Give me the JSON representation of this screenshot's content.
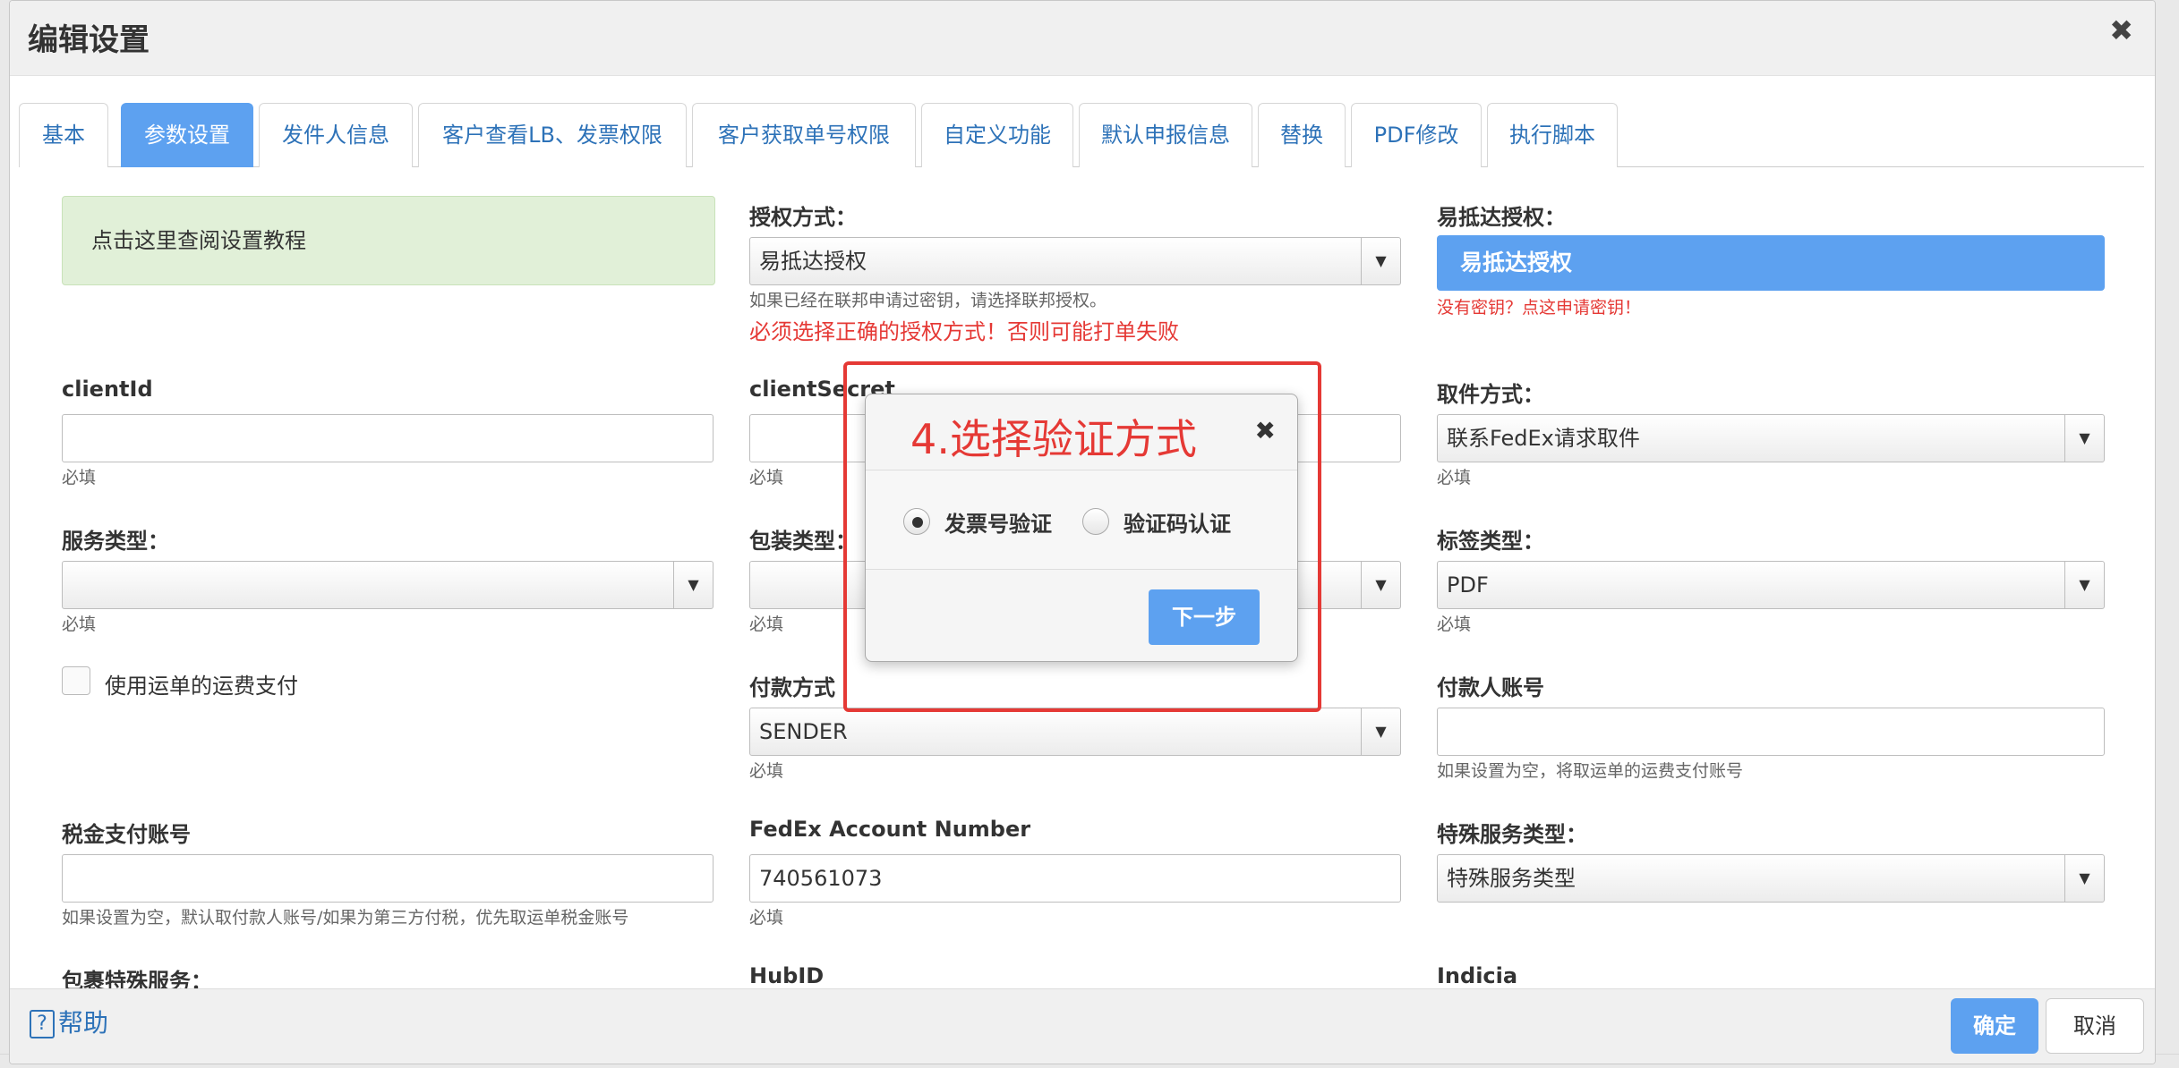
{
  "dialog": {
    "title": "编辑设置"
  },
  "tabs": [
    "基本",
    "参数设置",
    "发件人信息",
    "客户查看LB、发票权限",
    "客户获取单号权限",
    "自定义功能",
    "默认申报信息",
    "替换",
    "PDF修改",
    "执行脚本"
  ],
  "notice": "点击这里查阅设置教程",
  "auth": {
    "label": "授权方式：",
    "value": "易抵达授权",
    "help": "如果已经在联邦申请过密钥，请选择联邦授权。",
    "warning": "必须选择正确的授权方式！否则可能打单失败"
  },
  "yida_auth": {
    "label": "易抵达授权：",
    "button": "易抵达授权",
    "link": "没有密钥？点这申请密钥！"
  },
  "client_id": {
    "label": "clientId",
    "value": "",
    "help": "必填"
  },
  "client_secret": {
    "label": "clientSecret",
    "value": "",
    "help": "必填"
  },
  "pickup": {
    "label": "取件方式：",
    "value": "联系FedEx请求取件",
    "help": "必填"
  },
  "service_type": {
    "label": "服务类型：",
    "value": "",
    "help": "必填"
  },
  "package_type": {
    "label": "包装类型：",
    "value": "",
    "help": "必填"
  },
  "label_type": {
    "label": "标签类型：",
    "value": "PDF",
    "help": "必填"
  },
  "use_waybill_payment": {
    "label": "使用运单的运费支付",
    "checked": false
  },
  "payment_method": {
    "label": "付款方式",
    "value": "SENDER",
    "help": "必填"
  },
  "payer_account": {
    "label": "付款人账号",
    "value": "",
    "help": "如果设置为空，将取运单的运费支付账号"
  },
  "tax_account": {
    "label": "税金支付账号",
    "value": "",
    "help": "如果设置为空，默认取付款人账号/如果为第三方付税，优先取运单税金账号"
  },
  "fedex_account": {
    "label": "FedEx Account Number",
    "value": "740561073",
    "help": "必填"
  },
  "special_service": {
    "label": "特殊服务类型：",
    "value": "特殊服务类型"
  },
  "package_special": {
    "label": "包裹特殊服务："
  },
  "hub_id": {
    "label": "HubID"
  },
  "indicia": {
    "label": "Indicia"
  },
  "footer": {
    "help": "帮助",
    "help_icon": "?",
    "ok": "确定",
    "cancel": "取消"
  },
  "modal": {
    "title": "4.选择验证方式",
    "options": [
      {
        "label": "发票号验证",
        "checked": true
      },
      {
        "label": "验证码认证",
        "checked": false
      }
    ],
    "next": "下一步"
  },
  "icons": {
    "close": "✖",
    "dropdown": "▼"
  },
  "colors": {
    "accent": "#5da1f0",
    "link": "#2d72b8",
    "error": "#e53935",
    "notice_bg": "#e1f0d8"
  }
}
